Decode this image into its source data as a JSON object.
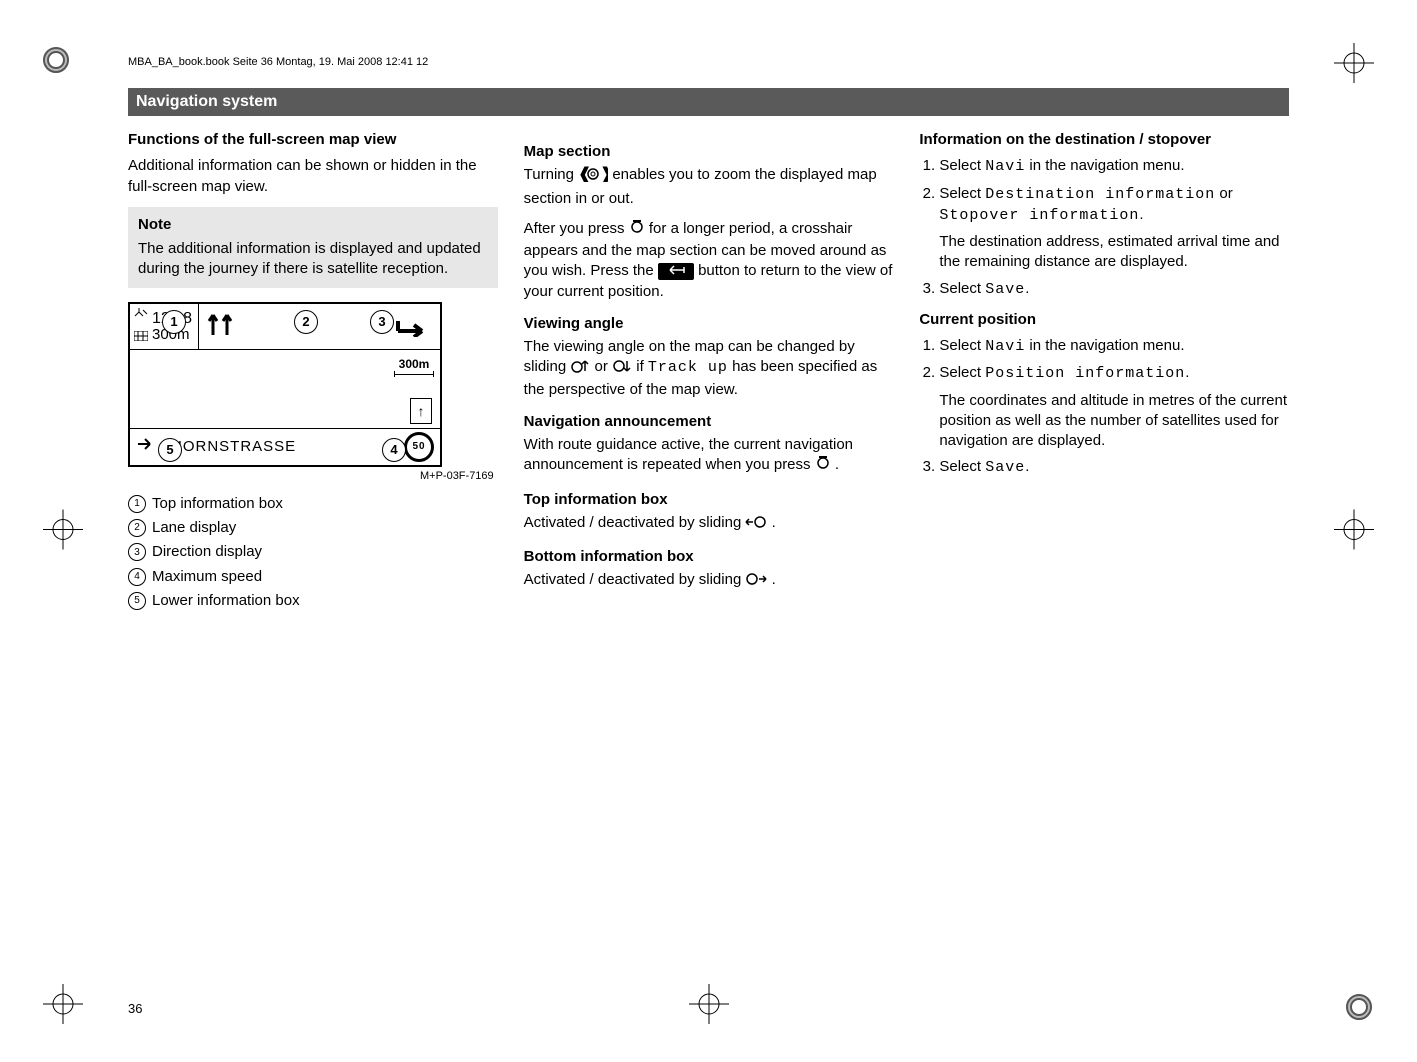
{
  "header_line": "MBA_BA_book.book  Seite 36  Montag, 19. Mai 2008  12:41 12",
  "title_bar": "Navigation system",
  "page_number": "36",
  "col1": {
    "h1": "Functions of the full-screen map view",
    "p1": "Additional information can be shown or hidden in the full-screen map view.",
    "note_head": "Note",
    "note_body": "The additional information is displayed and updated during the journey if there is satellite reception.",
    "fig": {
      "time": "12:08",
      "dist": "300m",
      "scale": "300m",
      "north": "↑",
      "street": "AHORNSTRASSE",
      "speed": "50",
      "ref": "M+P-03F-7169"
    },
    "legend": {
      "l1": "Top information box",
      "l2": "Lane display",
      "l3": "Direction display",
      "l4": "Maximum speed",
      "l5": "Lower information box"
    }
  },
  "col2": {
    "h1": "Map section",
    "p1a": "Turning ",
    "p1b": " enables you to zoom the displayed map section in or out.",
    "p2a": "After you press ",
    "p2b": " for a longer period, a crosshair appears and the map section can be moved around as you wish. Press the ",
    "p2c": " button to return to the view of your current position.",
    "h2": "Viewing angle",
    "p3a": "The viewing angle on the map can be changed by sliding ",
    "p3b": " or ",
    "p3c": " if ",
    "p3d": " has been specified as the perspective of the map view.",
    "track_up": "Track up",
    "h3": "Navigation announcement",
    "p4a": "With route guidance active, the current navigation announcement is repeated when you press ",
    "p4b": ".",
    "h4": "Top information box",
    "p5a": "Activated / deactivated by sliding ",
    "p5b": ".",
    "h5": "Bottom information box",
    "p6a": "Activated / deactivated by sliding ",
    "p6b": "."
  },
  "col3": {
    "h1": "Information on the destination / stopover",
    "s1_1a": "Select ",
    "navi": "Navi",
    "s1_1b": " in the navigation menu.",
    "s1_2a": "Select ",
    "dest_info": "Destination informa­tion",
    "s1_2b": " or ",
    "stop_info": "Stopover informa­tion",
    "s1_2c": ".",
    "s1_2d": "The destination address, estimated arrival time and the remaining distance are displayed.",
    "s1_3a": "Select ",
    "save": "Save",
    "s1_3b": ".",
    "h2": "Current position",
    "s2_1a": "Select ",
    "s2_1b": " in the navigation menu.",
    "s2_2a": "Select ",
    "pos_info": "Position information",
    "s2_2b": ".",
    "s2_2c": "The coordinates and altitude in metres of the current position as well as the number of satellites used for navigation are displayed.",
    "s2_3a": "Select ",
    "s2_3b": "."
  }
}
